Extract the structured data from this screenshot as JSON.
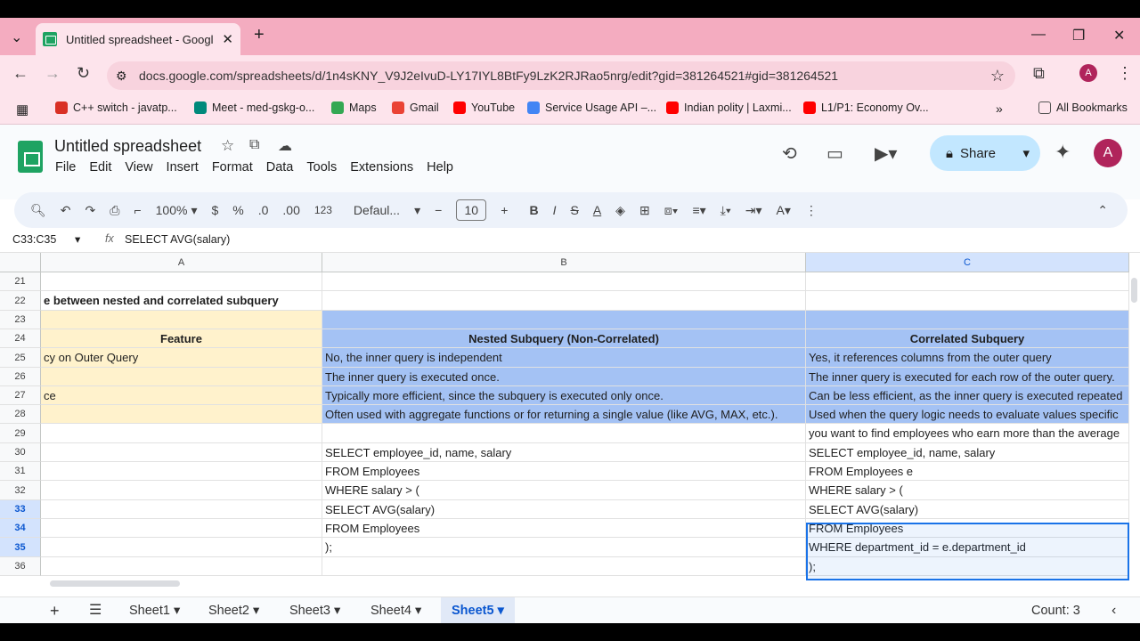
{
  "browser": {
    "tab_title": "Untitled spreadsheet - Google Sheets",
    "url": "docs.google.com/spreadsheets/d/1n4sKNY_V9J2eIvuD-LY17IYL8BtFy9LzK2RJRao5nrg/edit?gid=381264521#gid=381264521",
    "bookmarks": [
      "C++ switch - javatp...",
      "Meet - med-gskg-o...",
      "Maps",
      "Gmail",
      "YouTube",
      "Service Usage API –...",
      "Indian polity | Laxmi...",
      "L1/P1: Economy Ov..."
    ],
    "all_bookmarks": "All Bookmarks"
  },
  "doc": {
    "title": "Untitled spreadsheet",
    "menu": [
      "File",
      "Edit",
      "View",
      "Insert",
      "Format",
      "Data",
      "Tools",
      "Extensions",
      "Help"
    ],
    "share_label": "Share",
    "avatar_letter": "A"
  },
  "toolbar": {
    "zoom": "100%",
    "currency": "$",
    "percent": "%",
    "dec_dec": ".0",
    "dec_inc": ".00",
    "num_format": "123",
    "font": "Defaul...",
    "font_size": "10"
  },
  "formula": {
    "name_box": "C33:C35",
    "fx": "fx",
    "content": "SELECT AVG(salary)"
  },
  "columns": [
    "A",
    "B",
    "C"
  ],
  "rows": [
    {
      "n": "21",
      "a": "",
      "b": "",
      "c": ""
    },
    {
      "n": "22",
      "a": "e between nested and correlated subquery",
      "b": "",
      "c": ""
    },
    {
      "n": "23",
      "a": "",
      "b": "",
      "c": ""
    },
    {
      "n": "24",
      "a": "Feature",
      "b": "Nested Subquery (Non-Correlated)",
      "c": "Correlated Subquery"
    },
    {
      "n": "25",
      "a": "cy on Outer Query",
      "b": "No, the inner query is independent",
      "c": "Yes, it references columns from the outer query"
    },
    {
      "n": "26",
      "a": "",
      "b": "The inner query is executed once.",
      "c": "The inner query is executed for each row of the outer query."
    },
    {
      "n": "27",
      "a": "ce",
      "b": "Typically more efficient, since the subquery is executed only once.",
      "c": "Can be less efficient, as the inner query is executed repeated"
    },
    {
      "n": "28",
      "a": "",
      "b": "Often used with aggregate functions or for returning a single value (like AVG, MAX, etc.).",
      "c": "Used when the query logic needs to evaluate values specific"
    },
    {
      "n": "29",
      "a": "",
      "b": "",
      "c": "you want to find employees who earn more than the average"
    },
    {
      "n": "30",
      "a": "",
      "b": "SELECT employee_id, name, salary",
      "c": "SELECT employee_id, name, salary"
    },
    {
      "n": "31",
      "a": "",
      "b": "FROM Employees",
      "c": "FROM Employees e"
    },
    {
      "n": "32",
      "a": "",
      "b": "WHERE salary > (",
      "c": "WHERE salary > ("
    },
    {
      "n": "33",
      "a": "",
      "b": "SELECT AVG(salary)",
      "c": "SELECT AVG(salary)"
    },
    {
      "n": "34",
      "a": "",
      "b": "FROM Employees",
      "c": "FROM Employees"
    },
    {
      "n": "35",
      "a": "",
      "b": ");",
      "c": "WHERE department_id = e.department_id"
    },
    {
      "n": "36",
      "a": "",
      "b": "",
      "c": ");"
    }
  ],
  "sheets": [
    "Sheet1",
    "Sheet2",
    "Sheet3",
    "Sheet4",
    "Sheet5"
  ],
  "active_sheet": "Sheet5",
  "status": "Count: 3"
}
